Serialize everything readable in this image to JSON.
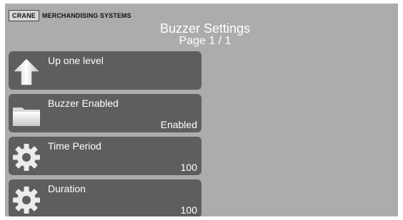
{
  "brand": {
    "logo_text": "CRANE",
    "name": "MERCHANDISING SYSTEMS"
  },
  "header": {
    "title": "Buzzer Settings",
    "page_indicator": "Page 1 / 1"
  },
  "menu": {
    "items": [
      {
        "label": "Up one level",
        "value": "",
        "icon": "up-arrow-icon"
      },
      {
        "label": "Buzzer Enabled",
        "value": "Enabled",
        "icon": "folder-icon"
      },
      {
        "label": "Time Period",
        "value": "100",
        "icon": "gear-icon"
      },
      {
        "label": "Duration",
        "value": "100",
        "icon": "gear-icon"
      }
    ]
  },
  "colors": {
    "screen_background": "#acacac",
    "menu_item_background": "#5e5e5e",
    "text": "#ffffff"
  }
}
